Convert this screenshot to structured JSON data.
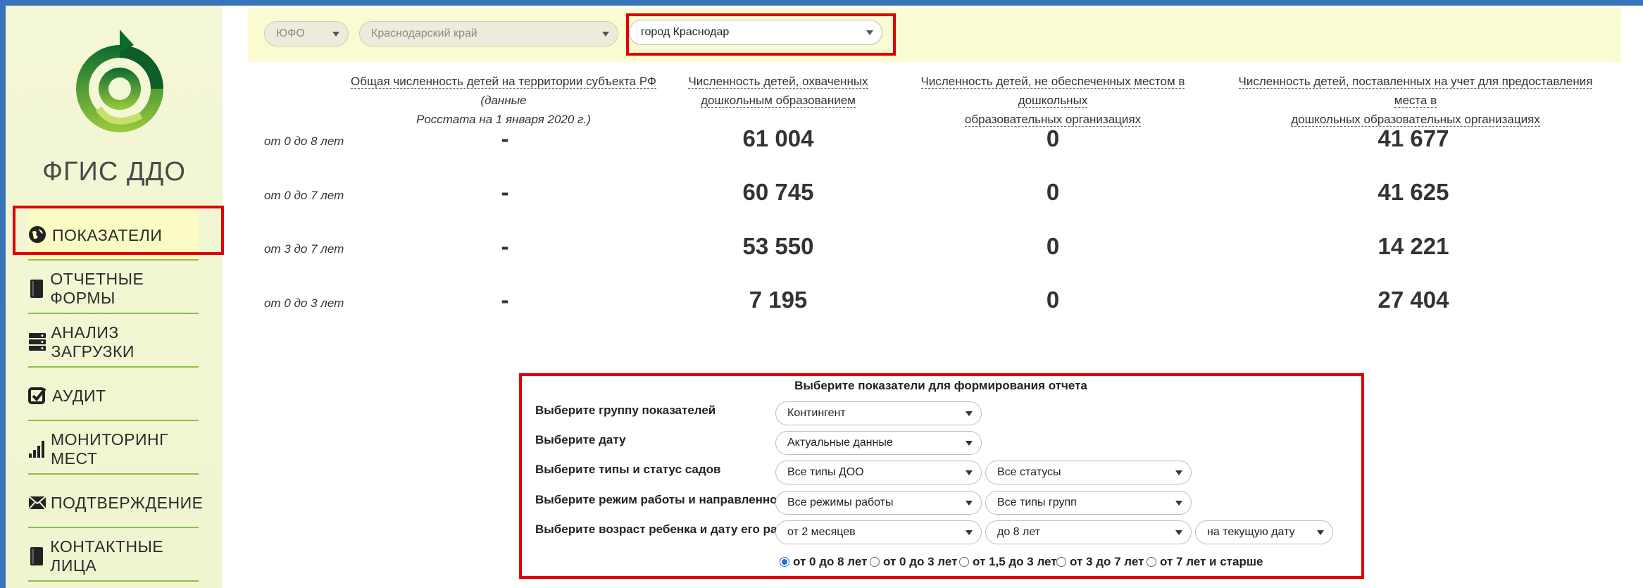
{
  "app": {
    "brand": "ФГИС ДДО"
  },
  "sidebar": {
    "items": [
      {
        "label": "ПОКАЗАТЕЛИ",
        "icon": "globe-icon"
      },
      {
        "label": "ОТЧЕТНЫЕ ФОРМЫ",
        "icon": "book-icon"
      },
      {
        "label": "АНАЛИЗ ЗАГРУЗКИ",
        "icon": "server-icon"
      },
      {
        "label": "АУДИТ",
        "icon": "checkbox-icon"
      },
      {
        "label": "МОНИТОРИНГ МЕСТ",
        "icon": "signal-bars-icon"
      },
      {
        "label": "ПОДТВЕРЖДЕНИЕ",
        "icon": "envelope-icon"
      },
      {
        "label": "КОНТАКТНЫЕ ЛИЦА",
        "icon": "book-icon"
      }
    ]
  },
  "filters": {
    "district": "ЮФО",
    "region": "Краснодарский край",
    "city": "город Краснодар"
  },
  "table": {
    "headers": [
      {
        "main": "Общая численность детей на территории субъекта РФ",
        "note": "(данные Росстата на 1 января 2020 г.)"
      },
      {
        "main": "Численность детей, охваченных дошкольным образованием",
        "note": ""
      },
      {
        "main": "Численность детей, не обеспеченных местом в дошкольных образовательных организациях",
        "note": ""
      },
      {
        "main": "Численность детей, поставленных на учет для предоставления места в дошкольных образовательных организациях",
        "note": ""
      }
    ],
    "header_lines": [
      [
        "Общая численность детей на территории субъекта РФ",
        "(данные",
        "Росстата на 1 января 2020 г.)"
      ],
      [
        "Численность детей, охваченных",
        "дошкольным образованием"
      ],
      [
        "Численность детей, не обеспеченных местом в дошкольных",
        "образовательных организациях"
      ],
      [
        "Численность детей, поставленных на учет для предоставления места в",
        "дошкольных образовательных организациях"
      ]
    ],
    "rows": [
      {
        "label": "от 0 до 8 лет",
        "values": [
          "-",
          "61 004",
          "0",
          "41 677"
        ]
      },
      {
        "label": "от 0 до 7 лет",
        "values": [
          "-",
          "60 745",
          "0",
          "41 625"
        ]
      },
      {
        "label": "от 3 до 7 лет",
        "values": [
          "-",
          "53 550",
          "0",
          "14 221"
        ]
      },
      {
        "label": "от 0 до 3 лет",
        "values": [
          "-",
          "7 195",
          "0",
          "27 404"
        ]
      }
    ]
  },
  "report": {
    "title": "Выберите показатели для формирования отчета",
    "labels": {
      "group": "Выберите группу показателей",
      "date": "Выберите дату",
      "types": "Выберите типы и статус садов",
      "mode": "Выберите режим работы и направленность",
      "age": "Выберите возраст ребенка и дату его расчета"
    },
    "selects": {
      "group": "Контингент",
      "date": "Актуальные данные",
      "doo_type": "Все типы ДОО",
      "status": "Все статусы",
      "work_mode": "Все режимы работы",
      "group_type": "Все типы групп",
      "age_from": "от 2 месяцев",
      "age_to": "до 8 лет",
      "calc_date": "на текущую дату"
    },
    "radios": [
      {
        "label": "от 0 до 8 лет",
        "checked": true
      },
      {
        "label": "от 0 до 3 лет",
        "checked": false
      },
      {
        "label": "от 1,5 до 3 лет",
        "checked": false
      },
      {
        "label": "от 3 до 7 лет",
        "checked": false
      },
      {
        "label": "от 7 лет и старше",
        "checked": false
      }
    ]
  },
  "colors": {
    "accent_border": "#3a74b8",
    "highlight": "#e00000",
    "sidebar_bg": "#f4f7d6",
    "separator": "#8bbf4a"
  }
}
